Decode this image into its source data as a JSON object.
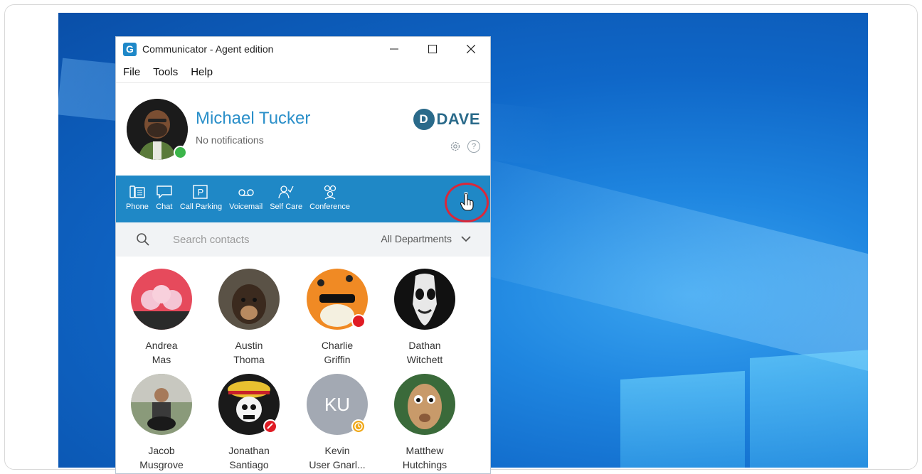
{
  "window": {
    "title": "Communicator - Agent edition",
    "controls": {
      "minimize": "—",
      "maximize": "☐",
      "close": "✕"
    }
  },
  "menu": [
    "File",
    "Tools",
    "Help"
  ],
  "profile": {
    "name": "Michael Tucker",
    "status_text": "No notifications",
    "presence": "available",
    "presence_color": "#3bb54a",
    "brand_letter": "D",
    "brand_name": "DAVE"
  },
  "toolbar": {
    "items": [
      {
        "label": "Phone",
        "icon": "phone-icon"
      },
      {
        "label": "Chat",
        "icon": "chat-icon"
      },
      {
        "label": "Call Parking",
        "icon": "parking-icon"
      },
      {
        "label": "Voicemail",
        "icon": "voicemail-icon"
      },
      {
        "label": "Self Care",
        "icon": "self-care-icon"
      },
      {
        "label": "Conference",
        "icon": "conference-icon"
      }
    ],
    "accent": "#1f88c6",
    "highlight_color": "#d9283a"
  },
  "search": {
    "placeholder": "Search contacts",
    "department": "All Departments"
  },
  "contacts": [
    {
      "first": "Andrea",
      "last": "Mas",
      "status": null
    },
    {
      "first": "Austin",
      "last": "Thoma",
      "status": null
    },
    {
      "first": "Charlie",
      "last": "Griffin",
      "status": "busy"
    },
    {
      "first": "Dathan",
      "last": "Witchett",
      "status": null
    },
    {
      "first": "Jacob",
      "last": "Musgrove",
      "status": null
    },
    {
      "first": "Jonathan",
      "last": "Santiago",
      "status": "on-call"
    },
    {
      "first": "Kevin",
      "last": "User Gnarl...",
      "status": "away",
      "initials": "KU"
    },
    {
      "first": "Matthew",
      "last": "Hutchings",
      "status": null
    }
  ]
}
